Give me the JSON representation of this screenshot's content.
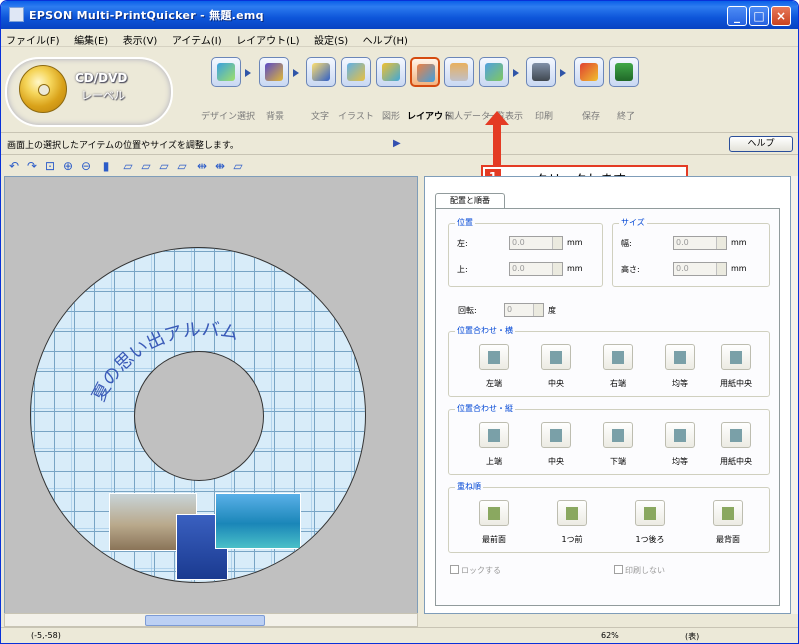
{
  "window": {
    "title": "EPSON Multi-PrintQuicker - 無題.emq"
  },
  "menu": [
    "ファイル(F)",
    "編集(E)",
    "表示(V)",
    "アイテム(I)",
    "レイアウト(L)",
    "設定(S)",
    "ヘルプ(H)"
  ],
  "logo": {
    "line1": "CD/DVD",
    "line2": "レーベル"
  },
  "toolbar": {
    "labels": [
      "デザイン選択",
      "背景",
      "文字",
      "イラスト",
      "図形",
      "レイアウト",
      "個人データ",
      "一覧表示",
      "印刷",
      "保存",
      "終了"
    ]
  },
  "status": {
    "message": "画面上の選択したアイテムの位置やサイズを調整します。",
    "help_label": "ヘルプ"
  },
  "callout": {
    "number": "1",
    "text": "クリックします"
  },
  "panel": {
    "tab": "配置と順番",
    "position": {
      "title": "位置",
      "left_label": "左:",
      "top_label": "上:",
      "left_value": "0.0",
      "top_value": "0.0",
      "unit": "mm"
    },
    "size": {
      "title": "サイズ",
      "width_label": "幅:",
      "height_label": "高さ:",
      "width_value": "0.0",
      "height_value": "0.0",
      "unit": "mm"
    },
    "rotation": {
      "label": "回転:",
      "value": "0",
      "unit": "度"
    },
    "align_h": {
      "title": "位置合わせ・横",
      "buttons": [
        "左端",
        "中央",
        "右端",
        "均等",
        "用紙中央"
      ]
    },
    "align_v": {
      "title": "位置合わせ・縦",
      "buttons": [
        "上端",
        "中央",
        "下端",
        "均等",
        "用紙中央"
      ]
    },
    "order": {
      "title": "重ね順",
      "buttons": [
        "最前面",
        "1つ前",
        "1つ後ろ",
        "最背面"
      ]
    },
    "lock_label": "ロックする",
    "noprint_label": "印刷しない"
  },
  "cd_text": "夏の思い出アルバム",
  "statusbar": {
    "coords": "(-5,-58)",
    "zoom": "62%",
    "sides": "(表)"
  }
}
